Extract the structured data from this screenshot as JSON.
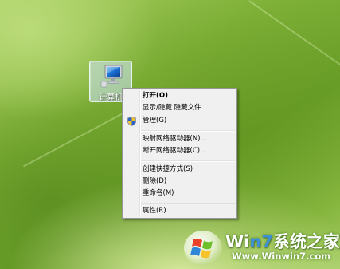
{
  "desktop": {
    "icons": [
      {
        "label": "计算机",
        "icon": "computer-icon"
      }
    ]
  },
  "context_menu": {
    "items": [
      {
        "label": "打开(O)",
        "bold": true
      },
      {
        "label": "显示/隐藏 隐藏文件"
      },
      {
        "label": "管理(G)",
        "icon": "uac-shield-icon"
      },
      {
        "separator": true
      },
      {
        "label": "映射网络驱动器(N)..."
      },
      {
        "label": "断开网络驱动器(C)..."
      },
      {
        "separator": true
      },
      {
        "label": "创建快捷方式(S)"
      },
      {
        "label": "删除(D)"
      },
      {
        "label": "重命名(M)"
      },
      {
        "separator": true
      },
      {
        "label": "属性(R)"
      }
    ]
  },
  "watermark": {
    "brand_prefix": "Wi",
    "brand_seven": "n7",
    "brand_suffix": "系统之家",
    "url": "Www.Winwin7.com"
  },
  "colors": {
    "menu_background": "#f0f0f0",
    "menu_border": "#979797",
    "icon_selection": "#cde4fa",
    "brand_blue": "#3f8fd6"
  }
}
